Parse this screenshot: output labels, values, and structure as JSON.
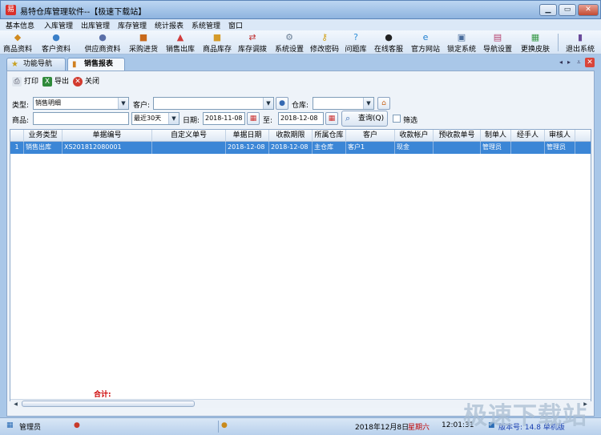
{
  "window": {
    "title": "易特仓库管理软件--【极速下载站】",
    "app_icon": "易",
    "controls": [
      "minimize",
      "maximize",
      "close"
    ]
  },
  "menu": [
    "基本信息",
    "入库管理",
    "出库管理",
    "库存管理",
    "统计报表",
    "系统管理",
    "窗口"
  ],
  "toolbar": [
    {
      "label": "商品资料",
      "icon": "goods-icon"
    },
    {
      "label": "客户资料",
      "icon": "customer-icon"
    },
    {
      "label": "供应商资料",
      "icon": "supplier-icon"
    },
    {
      "label": "采购进货",
      "icon": "truck-icon"
    },
    {
      "label": "销售出库",
      "icon": "sales-icon"
    },
    {
      "label": "商品库存",
      "icon": "box-icon"
    },
    {
      "label": "库存调拨",
      "icon": "transfer-icon"
    },
    {
      "label": "系统设置",
      "icon": "settings-icon"
    },
    {
      "label": "修改密码",
      "icon": "key-icon"
    },
    {
      "label": "问题库",
      "icon": "question-icon"
    },
    {
      "label": "在线客服",
      "icon": "qq-icon"
    },
    {
      "label": "官方网站",
      "icon": "ie-icon"
    },
    {
      "label": "锁定系统",
      "icon": "lock-icon"
    },
    {
      "label": "导航设置",
      "icon": "nav-icon"
    },
    {
      "label": "更换皮肤",
      "icon": "skin-icon"
    },
    {
      "label": "退出系统",
      "icon": "exit-icon"
    }
  ],
  "tabs": [
    {
      "label": "功能导航",
      "active": false
    },
    {
      "label": "销售报表",
      "active": true
    }
  ],
  "actions": {
    "print": "打印",
    "export": "导出",
    "close": "关闭"
  },
  "filters": {
    "type_label": "类型:",
    "type_value": "销售明细",
    "customer_label": "客户:",
    "customer_value": "",
    "warehouse_label": "仓库:",
    "warehouse_value": "",
    "goods_label": "商品:",
    "goods_value": "",
    "period_value": "最近30天",
    "date_label": "日期:",
    "date_from": "2018-11-08",
    "to_label": "至:",
    "date_to": "2018-12-08",
    "query_label": "查询(Q)",
    "filter_label": "筛选"
  },
  "table": {
    "columns": [
      "",
      "业务类型",
      "单据编号",
      "自定义单号",
      "单据日期",
      "收款期限",
      "所属仓库",
      "客户",
      "收款帐户",
      "预收款单号",
      "制单人",
      "经手人",
      "审核人"
    ],
    "rows": [
      [
        "1",
        "销售出库",
        "XS201812080001",
        "",
        "2018-12-08",
        "2018-12-08",
        "主仓库",
        "客户1",
        "现金",
        "",
        "管理员",
        "",
        "管理员"
      ]
    ],
    "total_label": "合计:"
  },
  "status": {
    "user": "管理员",
    "date": "2018年12月8日",
    "weekday": "星期六",
    "time": "12:01:31",
    "version": "版本号: 14.8 单机版"
  },
  "colors": {
    "selected_row": "#3b86d6",
    "weekday": "#c00000",
    "version": "#1a3fb0"
  },
  "watermark": "极速下载站"
}
